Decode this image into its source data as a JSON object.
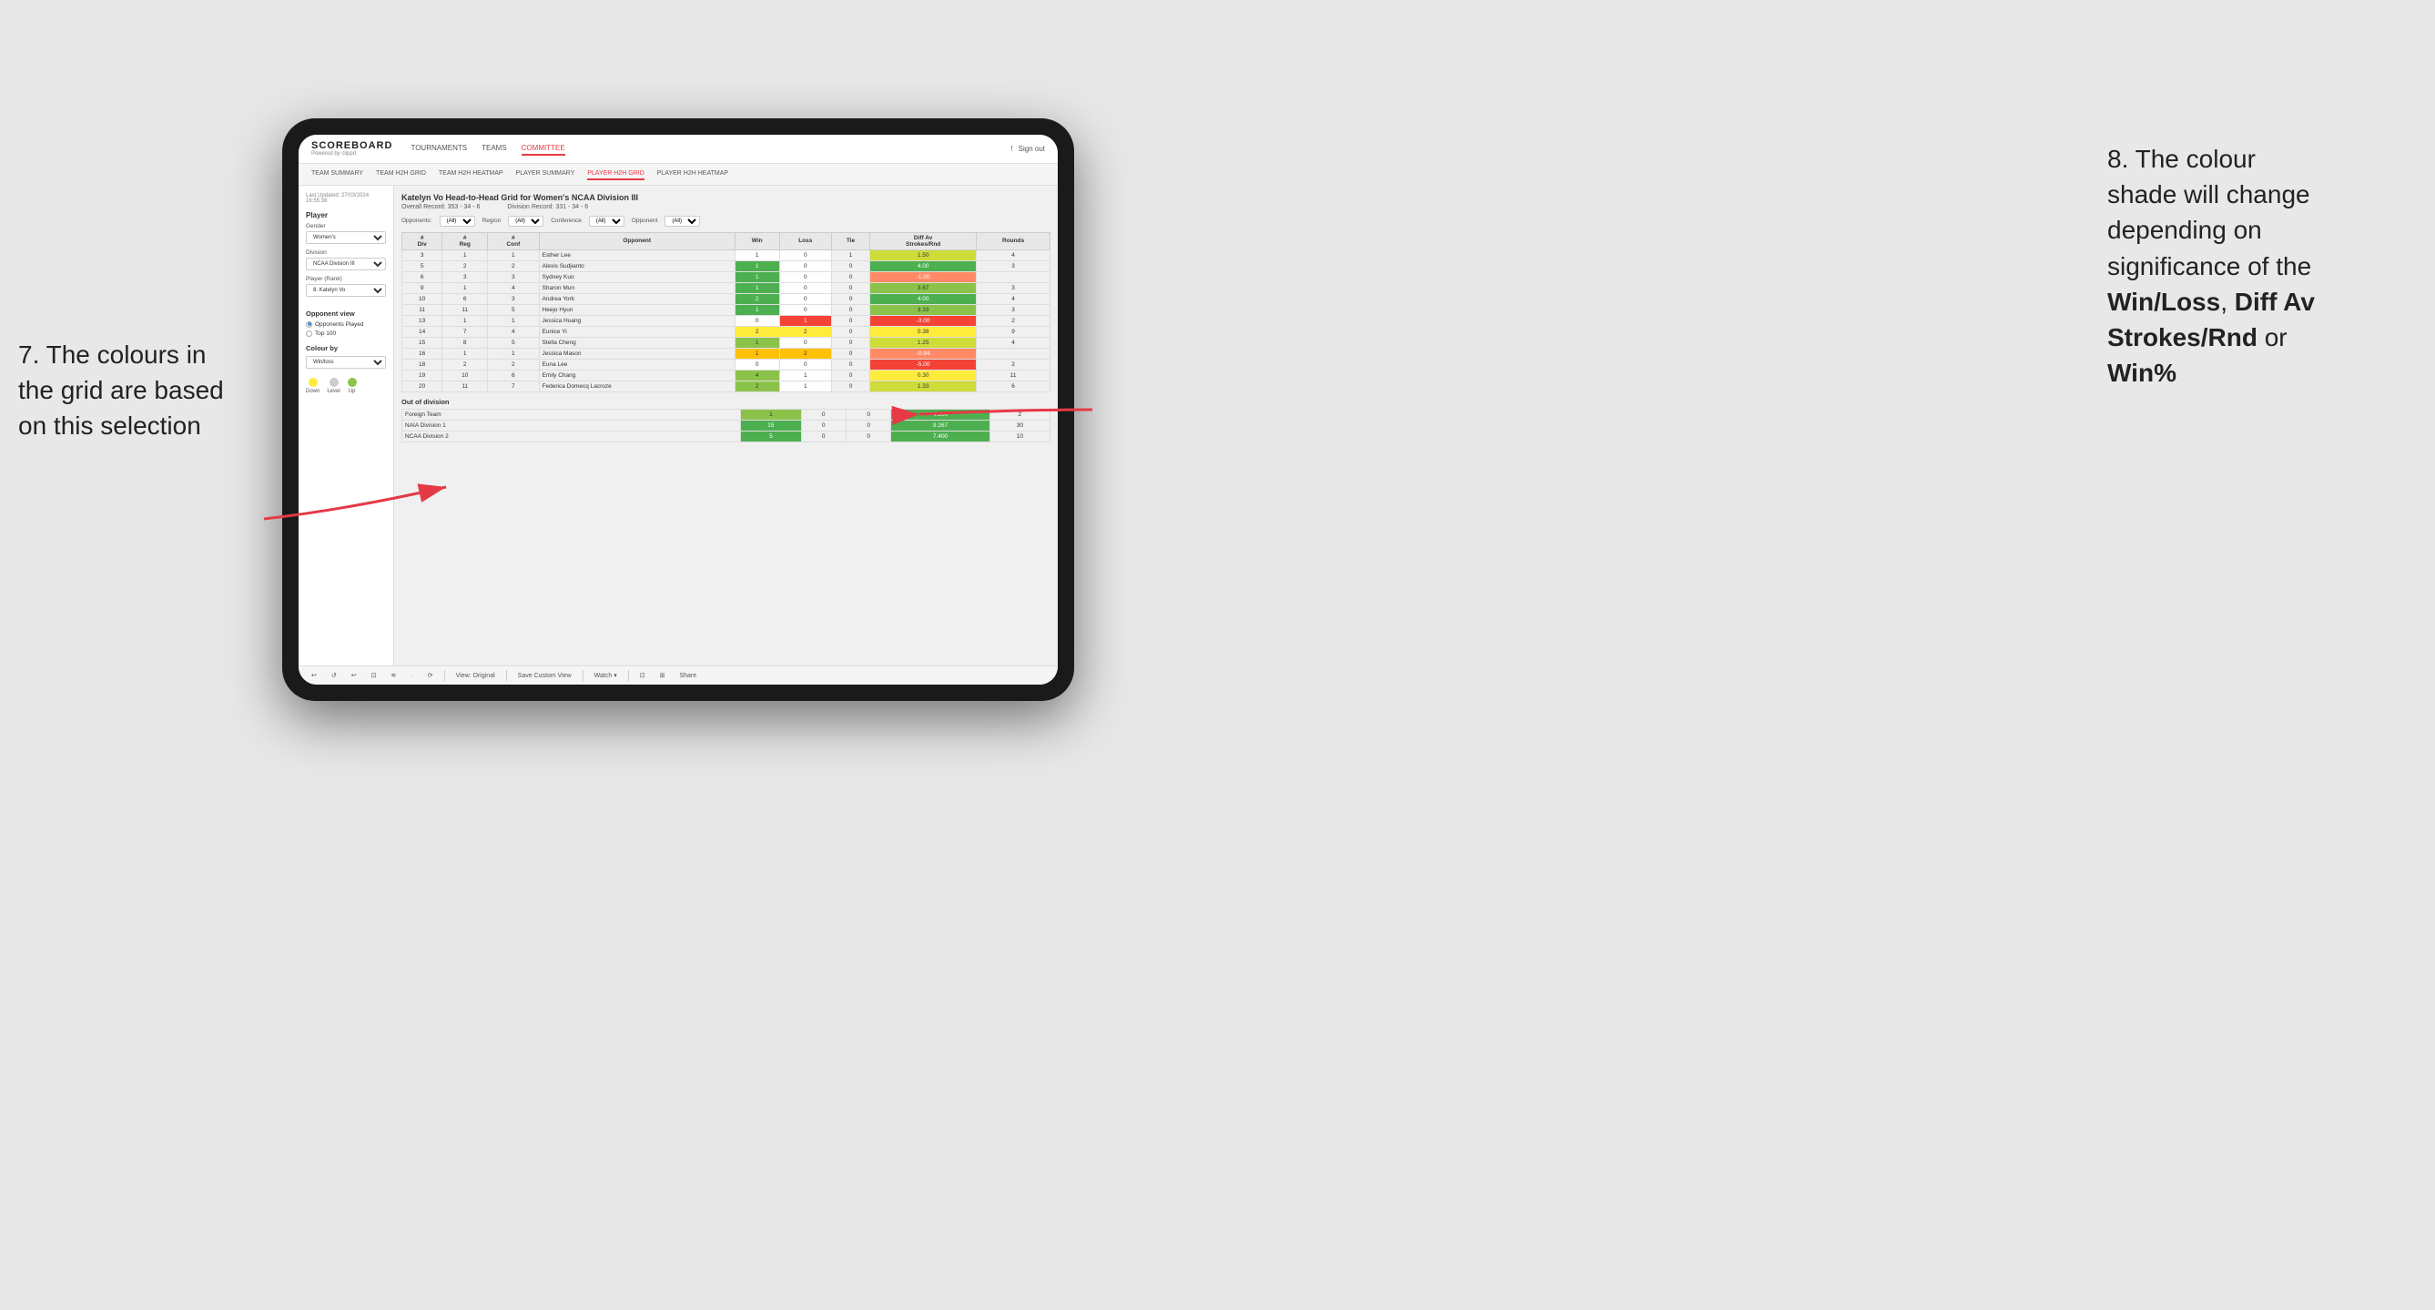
{
  "app": {
    "logo": "SCOREBOARD",
    "logo_sub": "Powered by clippd",
    "nav_links": [
      "TOURNAMENTS",
      "TEAMS",
      "COMMITTEE"
    ],
    "nav_right_items": [
      "!",
      "Sign out"
    ],
    "sub_nav_links": [
      "TEAM SUMMARY",
      "TEAM H2H GRID",
      "TEAM H2H HEATMAP",
      "PLAYER SUMMARY",
      "PLAYER H2H GRID",
      "PLAYER H2H HEATMAP"
    ]
  },
  "sidebar": {
    "timestamp": "Last Updated: 27/03/2024 16:55:38",
    "player_section": "Player",
    "gender_label": "Gender",
    "gender_value": "Women's",
    "division_label": "Division",
    "division_value": "NCAA Division III",
    "player_rank_label": "Player (Rank)",
    "player_rank_value": "8. Katelyn Vo",
    "opponent_view_title": "Opponent view",
    "radio_options": [
      "Opponents Played",
      "Top 100"
    ],
    "radio_selected": "Opponents Played",
    "colour_by_label": "Colour by",
    "colour_by_value": "Win/loss",
    "legend": [
      {
        "color": "#FFEB3B",
        "label": "Down"
      },
      {
        "color": "#ccc",
        "label": "Level"
      },
      {
        "color": "#8BC34A",
        "label": "Up"
      }
    ]
  },
  "grid": {
    "title": "Katelyn Vo Head-to-Head Grid for Women's NCAA Division III",
    "overall_record_label": "Overall Record:",
    "overall_record": "353 - 34 - 6",
    "division_record_label": "Division Record:",
    "division_record": "331 - 34 - 6",
    "filter_labels": [
      "Opponents:",
      "Region",
      "Conference",
      "Opponent"
    ],
    "filter_values": [
      "(All)",
      "(All)",
      "(All)",
      "(All)"
    ],
    "column_headers": [
      "#\nDiv",
      "#\nReg",
      "#\nConf",
      "Opponent",
      "Win",
      "Loss",
      "Tie",
      "Diff Av\nStrokes/Rnd",
      "Rounds"
    ],
    "rows": [
      {
        "div": "3",
        "reg": "1",
        "conf": "1",
        "opponent": "Esther Lee",
        "win": "1",
        "loss": "0",
        "tie": "1",
        "diff": "1.50",
        "rounds": "4",
        "win_color": "white",
        "loss_color": "white",
        "diff_color": "green_light"
      },
      {
        "div": "5",
        "reg": "2",
        "conf": "2",
        "opponent": "Alexis Sudjianto",
        "win": "1",
        "loss": "0",
        "tie": "0",
        "diff": "4.00",
        "rounds": "3",
        "win_color": "green_dark",
        "loss_color": "white",
        "diff_color": "green_dark"
      },
      {
        "div": "6",
        "reg": "3",
        "conf": "3",
        "opponent": "Sydney Kuo",
        "win": "1",
        "loss": "0",
        "tie": "0",
        "diff": "-1.00",
        "rounds": "",
        "win_color": "green_dark",
        "loss_color": "white",
        "diff_color": "red_light"
      },
      {
        "div": "9",
        "reg": "1",
        "conf": "4",
        "opponent": "Sharon Mun",
        "win": "1",
        "loss": "0",
        "tie": "0",
        "diff": "3.67",
        "rounds": "3",
        "win_color": "green_dark",
        "loss_color": "white",
        "diff_color": "green_med"
      },
      {
        "div": "10",
        "reg": "6",
        "conf": "3",
        "opponent": "Andrea York",
        "win": "2",
        "loss": "0",
        "tie": "0",
        "diff": "4.00",
        "rounds": "4",
        "win_color": "green_dark",
        "loss_color": "white",
        "diff_color": "green_dark"
      },
      {
        "div": "11",
        "reg": "11",
        "conf": "5",
        "opponent": "Heejo Hyun",
        "win": "1",
        "loss": "0",
        "tie": "0",
        "diff": "3.33",
        "rounds": "3",
        "win_color": "green_dark",
        "loss_color": "white",
        "diff_color": "green_med"
      },
      {
        "div": "13",
        "reg": "1",
        "conf": "1",
        "opponent": "Jessica Huang",
        "win": "0",
        "loss": "1",
        "tie": "0",
        "diff": "-3.00",
        "rounds": "2",
        "win_color": "white",
        "loss_color": "red",
        "diff_color": "red"
      },
      {
        "div": "14",
        "reg": "7",
        "conf": "4",
        "opponent": "Eunice Yi",
        "win": "2",
        "loss": "2",
        "tie": "0",
        "diff": "0.38",
        "rounds": "9",
        "win_color": "yellow",
        "loss_color": "yellow",
        "diff_color": "yellow"
      },
      {
        "div": "15",
        "reg": "8",
        "conf": "5",
        "opponent": "Stella Cheng",
        "win": "1",
        "loss": "0",
        "tie": "0",
        "diff": "1.25",
        "rounds": "4",
        "win_color": "green_med",
        "loss_color": "white",
        "diff_color": "green_light"
      },
      {
        "div": "16",
        "reg": "1",
        "conf": "1",
        "opponent": "Jessica Mason",
        "win": "1",
        "loss": "2",
        "tie": "0",
        "diff": "-0.94",
        "rounds": "",
        "win_color": "orange",
        "loss_color": "orange",
        "diff_color": "red_light"
      },
      {
        "div": "18",
        "reg": "2",
        "conf": "2",
        "opponent": "Euna Lee",
        "win": "0",
        "loss": "0",
        "tie": "0",
        "diff": "-5.00",
        "rounds": "2",
        "win_color": "white",
        "loss_color": "white",
        "diff_color": "red"
      },
      {
        "div": "19",
        "reg": "10",
        "conf": "6",
        "opponent": "Emily Chang",
        "win": "4",
        "loss": "1",
        "tie": "0",
        "diff": "0.30",
        "rounds": "11",
        "win_color": "green_med",
        "loss_color": "white",
        "diff_color": "yellow"
      },
      {
        "div": "20",
        "reg": "11",
        "conf": "7",
        "opponent": "Federica Domecq Lacroze",
        "win": "2",
        "loss": "1",
        "tie": "0",
        "diff": "1.33",
        "rounds": "6",
        "win_color": "green_med",
        "loss_color": "white",
        "diff_color": "green_light"
      }
    ],
    "out_of_division_title": "Out of division",
    "out_of_division_rows": [
      {
        "opponent": "Foreign Team",
        "win": "1",
        "loss": "0",
        "tie": "0",
        "diff": "4.500",
        "rounds": "2",
        "win_color": "green_med",
        "diff_color": "green_dark"
      },
      {
        "opponent": "NAIA Division 1",
        "win": "15",
        "loss": "0",
        "tie": "0",
        "diff": "9.267",
        "rounds": "30",
        "win_color": "green_dark",
        "diff_color": "green_dark"
      },
      {
        "opponent": "NCAA Division 2",
        "win": "5",
        "loss": "0",
        "tie": "0",
        "diff": "7.400",
        "rounds": "10",
        "win_color": "green_dark",
        "diff_color": "green_dark"
      }
    ]
  },
  "toolbar": {
    "items": [
      "↩",
      "↺",
      "↩",
      "⊡",
      "≋",
      "·",
      "⟳",
      "|",
      "View: Original",
      "|",
      "Save Custom View",
      "|",
      "Watch ▾",
      "|",
      "⊡",
      "⊞",
      "Share"
    ]
  },
  "annotations": {
    "left": {
      "title": "7. The colours in\nthe grid are based\non this selection"
    },
    "right": {
      "title": "8. The colour\nshade will change\ndepending on\nsignificance of the\n",
      "bold_items": [
        "Win/Loss",
        "Diff Av\nStrokes/Rnd",
        "Win%"
      ],
      "body": " or\n"
    }
  }
}
